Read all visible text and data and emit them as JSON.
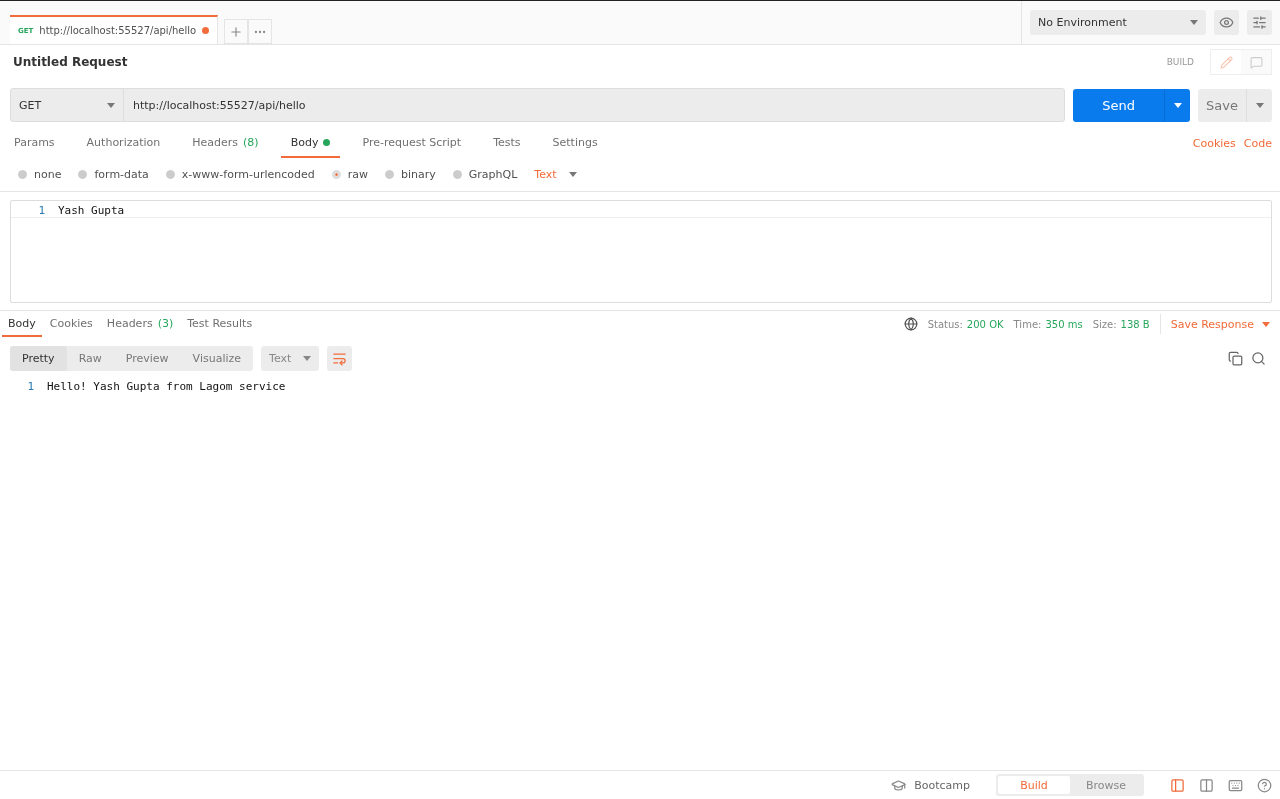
{
  "tabs": [
    {
      "method": "GET",
      "url": "http://localhost:55527/api/hello",
      "selected": true,
      "unsaved": true
    }
  ],
  "environment": {
    "value": "No Environment"
  },
  "request": {
    "title": "Untitled Request",
    "mode_label": "BUILD",
    "method": "GET",
    "url": "http://localhost:55527/api/hello",
    "send": "Send",
    "save": "Save"
  },
  "request_tabs": [
    {
      "label": "Params",
      "selected": false,
      "has_body": false
    },
    {
      "label": "Authorization",
      "selected": false,
      "has_body": false
    },
    {
      "label": "Headers",
      "count": "(8)",
      "selected": false,
      "has_body": false
    },
    {
      "label": "Body",
      "selected": true,
      "has_body": true
    },
    {
      "label": "Pre-request Script",
      "selected": false,
      "has_body": false
    },
    {
      "label": "Tests",
      "selected": false,
      "has_body": false
    },
    {
      "label": "Settings",
      "selected": false,
      "has_body": false
    }
  ],
  "request_links": [
    "Cookies",
    "Code"
  ],
  "body_types": [
    {
      "label": "none",
      "selected": false
    },
    {
      "label": "form-data",
      "selected": false
    },
    {
      "label": "x-www-form-urlencoded",
      "selected": false
    },
    {
      "label": "raw",
      "selected": true
    },
    {
      "label": "binary",
      "selected": false
    },
    {
      "label": "GraphQL",
      "selected": false
    }
  ],
  "body_format": "Text",
  "editor_lines": [
    {
      "number": "1",
      "text": "Yash Gupta"
    }
  ],
  "response_tabs": [
    {
      "label": "Body",
      "selected": true
    },
    {
      "label": "Cookies",
      "selected": false
    },
    {
      "label": "Headers",
      "count": "(3)",
      "selected": false
    },
    {
      "label": "Test Results",
      "selected": false
    }
  ],
  "response_meta": [
    {
      "label": "Status:",
      "value": "200 OK"
    },
    {
      "label": "Time:",
      "value": "350 ms"
    },
    {
      "label": "Size:",
      "value": "138 B"
    }
  ],
  "save_response": "Save Response",
  "view_modes": [
    {
      "label": "Pretty",
      "selected": true
    },
    {
      "label": "Raw",
      "selected": false
    },
    {
      "label": "Preview",
      "selected": false
    },
    {
      "label": "Visualize",
      "selected": false
    }
  ],
  "response_format": "Text",
  "wrap_lines": true,
  "response_lines": [
    {
      "number": "1",
      "text": "Hello! Yash Gupta from Lagom service"
    }
  ],
  "footer": {
    "bootcamp": "Bootcamp",
    "modes": [
      {
        "label": "Build",
        "selected": true
      },
      {
        "label": "Browse",
        "selected": false
      }
    ]
  }
}
